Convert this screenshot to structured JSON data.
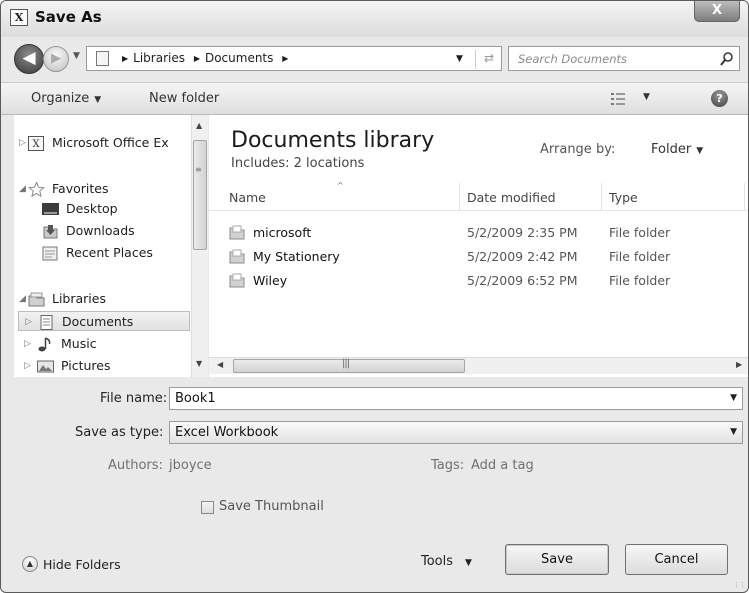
{
  "window": {
    "title": "Save As",
    "close_glyph": "X",
    "app_icon_glyph": "X"
  },
  "nav": {
    "breadcrumbs": [
      "Libraries",
      "Documents"
    ],
    "search_placeholder": "Search Documents"
  },
  "toolbar": {
    "organize": "Organize",
    "new_folder": "New folder"
  },
  "sidebar": {
    "items": [
      {
        "label": "Microsoft Office Ex",
        "icon": "excel-icon"
      },
      {
        "label": "Favorites",
        "icon": "star-icon"
      },
      {
        "label": "Desktop",
        "icon": "desktop-icon"
      },
      {
        "label": "Downloads",
        "icon": "downloads-icon"
      },
      {
        "label": "Recent Places",
        "icon": "recent-places-icon"
      },
      {
        "label": "Libraries",
        "icon": "libraries-icon"
      },
      {
        "label": "Documents",
        "icon": "documents-icon",
        "selected": true
      },
      {
        "label": "Music",
        "icon": "music-icon"
      },
      {
        "label": "Pictures",
        "icon": "pictures-icon"
      }
    ]
  },
  "content": {
    "library_title": "Documents library",
    "includes": "Includes: 2 locations",
    "arrange_label": "Arrange by:",
    "arrange_value": "Folder",
    "columns": [
      "Name",
      "Date modified",
      "Type"
    ],
    "files": [
      {
        "name": "microsoft",
        "date": "5/2/2009 2:35 PM",
        "type": "File folder"
      },
      {
        "name": "My Stationery",
        "date": "5/2/2009 2:42 PM",
        "type": "File folder"
      },
      {
        "name": "Wiley",
        "date": "5/2/2009 6:52 PM",
        "type": "File folder"
      }
    ]
  },
  "form": {
    "file_name_label": "File name:",
    "file_name_value": "Book1",
    "save_type_label": "Save as type:",
    "save_type_value": "Excel Workbook",
    "authors_label": "Authors:",
    "authors_value": "jboyce",
    "tags_label": "Tags:",
    "tags_value": "Add a tag",
    "thumbnail_label": "Save Thumbnail",
    "thumbnail_checked": false
  },
  "footer": {
    "hide_folders": "Hide Folders",
    "tools": "Tools",
    "save": "Save",
    "cancel": "Cancel"
  }
}
